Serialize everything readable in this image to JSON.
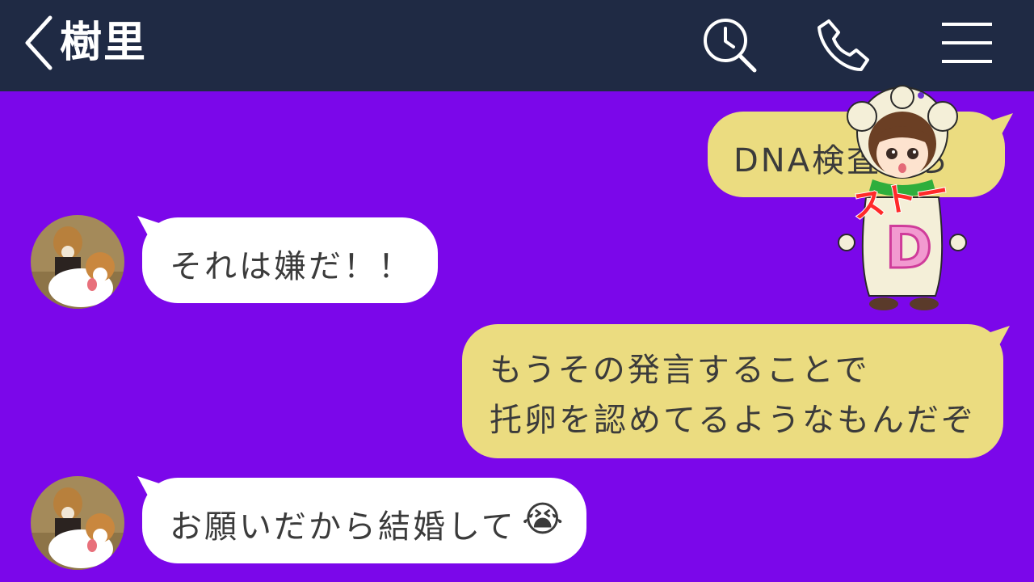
{
  "header": {
    "title": "樹里",
    "back_icon": "chevron-left-icon",
    "search_icon": "clock-search-icon",
    "call_icon": "phone-icon",
    "menu_icon": "hamburger-menu-icon",
    "bg_color": "#1f2a44"
  },
  "chat": {
    "bg_color": "#7b07ea",
    "incoming_bubble_color": "#ffffff",
    "outgoing_bubble_color": "#ebdc80",
    "messages": [
      {
        "side": "out",
        "text": "DNA検査しろ"
      },
      {
        "side": "in",
        "text": "それは嫌だ！！"
      },
      {
        "side": "out",
        "line1": "もうその発言することで",
        "line2": "托卵を認めてるようなもんだぞ"
      },
      {
        "side": "in",
        "text": "お願いだから結婚して",
        "emoji": "😭"
      }
    ]
  },
  "overlay": {
    "label": "ストー",
    "letter": "D"
  }
}
